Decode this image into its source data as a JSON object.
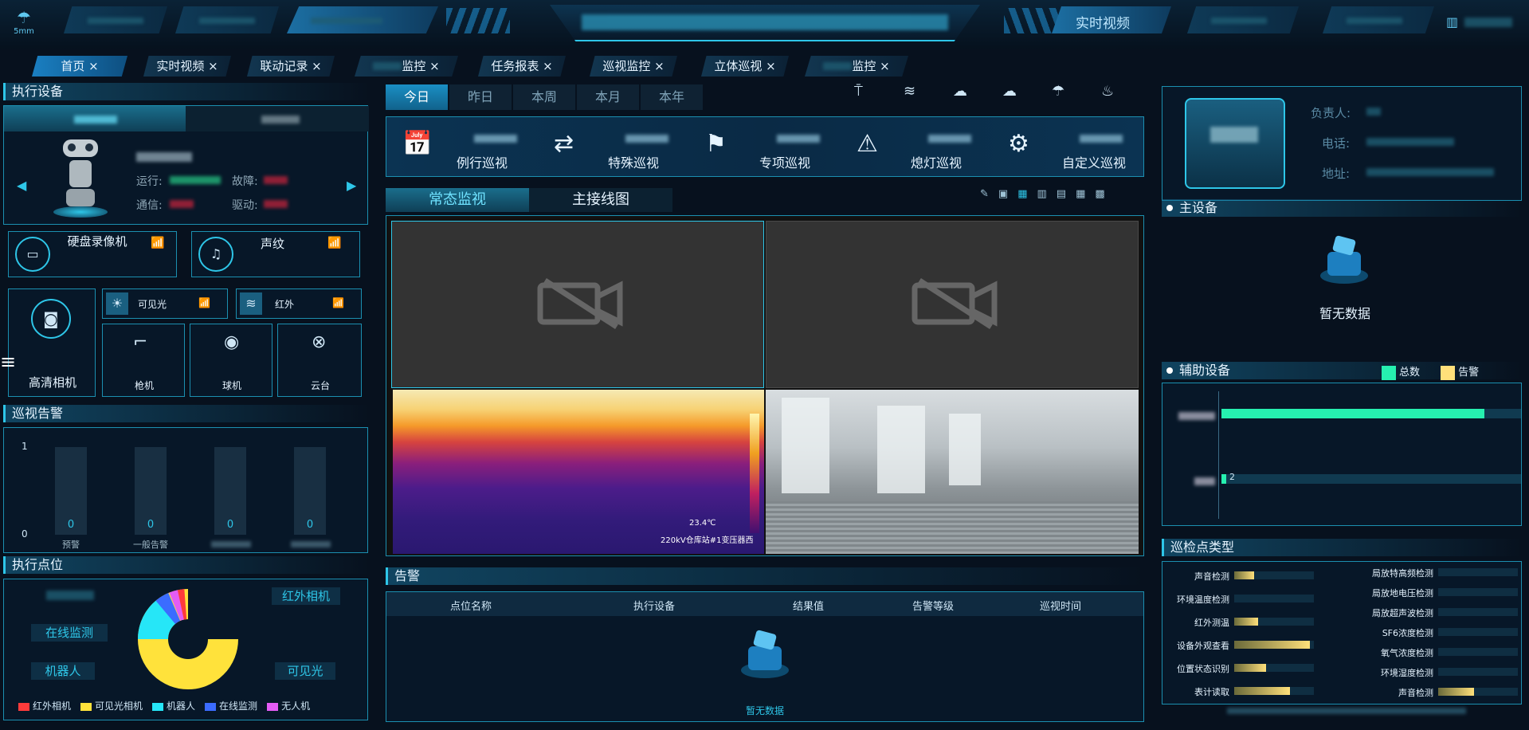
{
  "topbar": {
    "weather_label": "5mm",
    "right_nav_label": "实时视频"
  },
  "tabs": [
    {
      "label": "首页"
    },
    {
      "label": "实时视频"
    },
    {
      "label": "联动记录"
    },
    {
      "label": "监控"
    },
    {
      "label": "任务报表"
    },
    {
      "label": "巡视监控"
    },
    {
      "label": "立体巡视"
    },
    {
      "label": "监控"
    }
  ],
  "left": {
    "exec_device_title": "执行设备",
    "robot_stats": {
      "run": "运行:",
      "fault": "故障:",
      "comm": "通信:",
      "drive": "驱动:"
    },
    "devices": {
      "hdd": "硬盘录像机",
      "voiceprint": "声纹",
      "visible": "可见光",
      "infrared": "红外",
      "hd_camera": "高清相机",
      "gun": "枪机",
      "ball": "球机",
      "ptz": "云台"
    },
    "alarm_title": "巡视告警",
    "alarm_chart": {
      "y_top": "1",
      "y_bottom": "0",
      "bar_values": [
        "0",
        "0",
        "0",
        "0"
      ],
      "bar_labels": [
        "预警",
        "一般告警",
        "",
        ""
      ]
    },
    "point_title": "执行点位",
    "donut_labels": {
      "infrared": "红外相机",
      "online": "在线监测",
      "robot": "机器人",
      "visible": "可见光"
    },
    "legend": [
      {
        "label": "红外相机",
        "color": "#ff3b3b"
      },
      {
        "label": "可见光相机",
        "color": "#ffe23b"
      },
      {
        "label": "机器人",
        "color": "#26e6f7"
      },
      {
        "label": "在线监测",
        "color": "#3b6cff"
      },
      {
        "label": "无人机",
        "color": "#e45cf5"
      }
    ]
  },
  "center": {
    "periods": [
      "今日",
      "昨日",
      "本周",
      "本月",
      "本年"
    ],
    "patrol_types": [
      "例行巡视",
      "特殊巡视",
      "专项巡视",
      "熄灯巡视",
      "自定义巡视"
    ],
    "view_tabs": [
      "常态监视",
      "主接线图"
    ],
    "thermal_reading": "23.4℃",
    "thermal_caption": "220kV仓库站#1变压器西",
    "alarm_title": "告警",
    "alarm_columns": [
      "点位名称",
      "执行设备",
      "结果值",
      "告警等级",
      "巡视时间"
    ],
    "empty_text": "暂无数据"
  },
  "right": {
    "info_labels": {
      "owner": "负责人:",
      "phone": "电话:",
      "address": "地址:"
    },
    "main_device_title": "主设备",
    "empty_text": "暂无数据",
    "aux_title": "辅助设备",
    "aux_legend": {
      "total": "总数",
      "alarm": "告警"
    },
    "aux_bar_value_2": "2",
    "point_type_title": "巡检点类型",
    "point_types_left": [
      "声音检测",
      "环境温度检测",
      "红外测温",
      "设备外观查看",
      "位置状态识别",
      "表计读取"
    ],
    "point_types_right": [
      "局放特高频检测",
      "局放地电压检测",
      "局放超声波检测",
      "SF6浓度检测",
      "氧气浓度检测",
      "环境湿度检测",
      "声音检测"
    ],
    "point_levels_left": [
      0.25,
      0,
      0.3,
      0.95,
      0.4,
      0.7
    ],
    "point_levels_right": [
      0,
      0,
      0,
      0,
      0,
      0,
      0.45
    ]
  },
  "colors": {
    "accent": "#2ec6e8",
    "aux_total": "#26f0b0",
    "aux_alarm": "#ffe07a"
  }
}
